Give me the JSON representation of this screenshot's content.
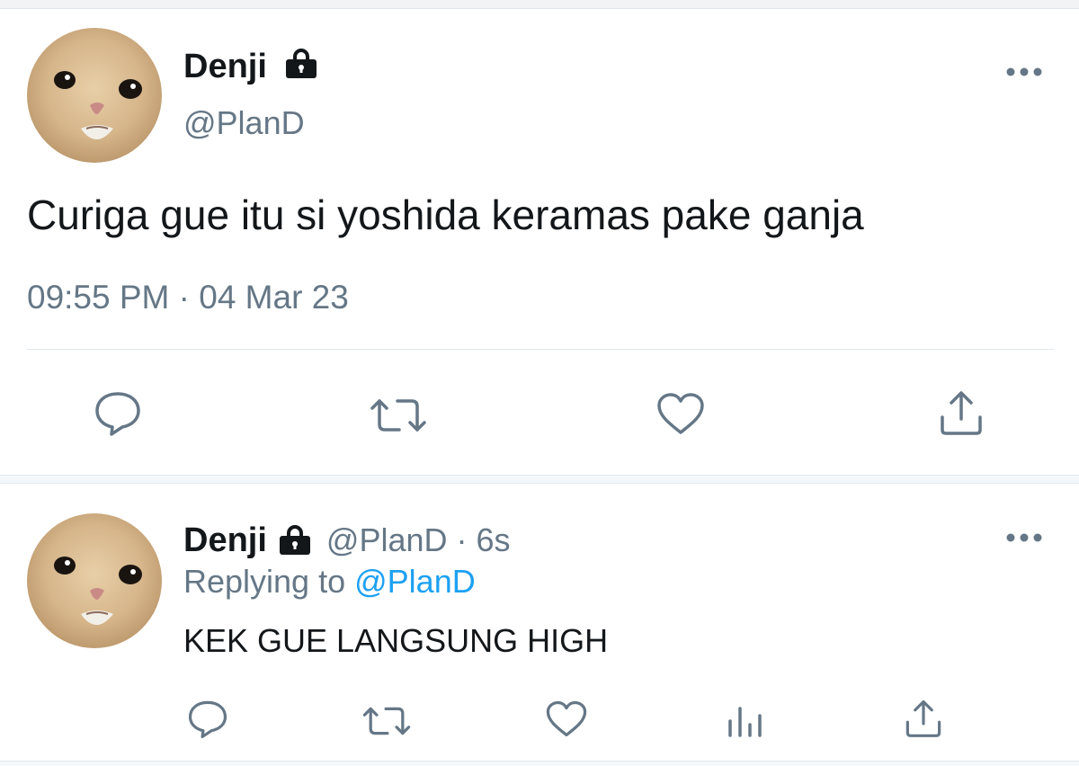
{
  "main_tweet": {
    "author_name": "Denji",
    "author_handle": "@PlanD",
    "text": "Curiga gue itu si yoshida keramas pake ganja",
    "timestamp": "09:55 PM · 04 Mar 23",
    "actions": [
      "reply-icon",
      "retweet-icon",
      "like-icon",
      "share-icon"
    ]
  },
  "reply_tweet": {
    "author_name": "Denji",
    "author_handle": "@PlanD",
    "time_sep": "·",
    "time_ago": "6s",
    "replying_prefix": "Replying to",
    "replying_handle": "@PlanD",
    "text": "KEK GUE LANGSUNG HIGH",
    "actions": [
      "reply-icon",
      "retweet-icon",
      "like-icon",
      "analytics-icon",
      "share-icon"
    ]
  },
  "colors": {
    "text": "#14171a",
    "muted": "#657786",
    "link": "#1da1f2",
    "icon": "#657786"
  }
}
